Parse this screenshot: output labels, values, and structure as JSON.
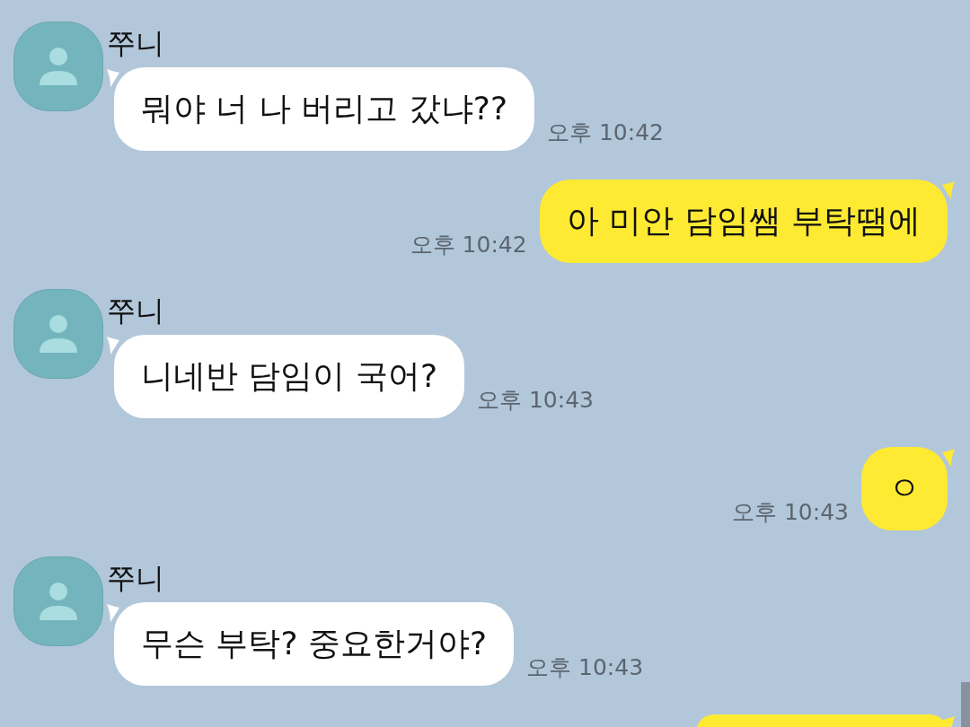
{
  "messages": [
    {
      "kind": "received",
      "sender": "쭈니",
      "text": "뭐야 너 나 버리고 갔냐??",
      "time": "오후 10:42"
    },
    {
      "kind": "sent",
      "text": "아 미안 담임쌤 부탁땜에",
      "time": "오후 10:42"
    },
    {
      "kind": "received",
      "sender": "쭈니",
      "text": "니네반 담임이 국어?",
      "time": "오후 10:43"
    },
    {
      "kind": "sent",
      "text": "ㅇ",
      "time": "오후 10:43"
    },
    {
      "kind": "received",
      "sender": "쭈니",
      "text": "무슨 부탁? 중요한거야?",
      "time": "오후 10:43"
    },
    {
      "kind": "sent"
    }
  ]
}
